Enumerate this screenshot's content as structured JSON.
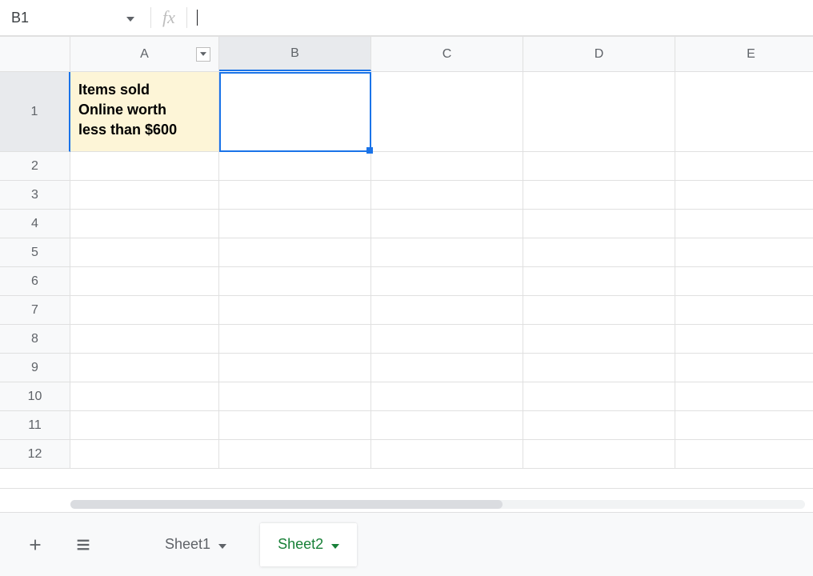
{
  "namebox": {
    "ref": "B1"
  },
  "fx": {
    "label": "fx",
    "value": ""
  },
  "columns": [
    "A",
    "B",
    "C",
    "D",
    "E"
  ],
  "rows": [
    "1",
    "2",
    "3",
    "4",
    "5",
    "6",
    "7",
    "8",
    "9",
    "10",
    "11",
    "12"
  ],
  "selected": {
    "col": "B",
    "row": "1"
  },
  "cells": {
    "A1": "Items sold\nOnline worth\nless than $600"
  },
  "tabs": [
    {
      "name": "Sheet1",
      "active": false
    },
    {
      "name": "Sheet2",
      "active": true
    }
  ]
}
